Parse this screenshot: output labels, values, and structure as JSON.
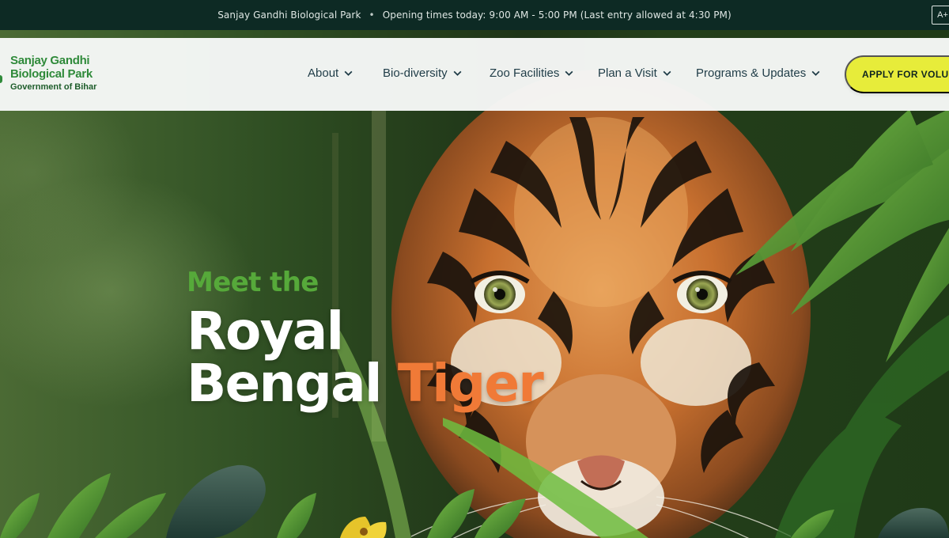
{
  "topbar": {
    "park_name": "Sanjay Gandhi Biological Park",
    "separator": "•",
    "timings": "Opening times today: 9:00 AM - 5:00 PM (Last entry allowed at 4:30 PM)",
    "font_size_button": "A+"
  },
  "logo": {
    "line1": "Sanjay Gandhi",
    "line2": "Biological Park",
    "line3": "Government of Bihar"
  },
  "nav": {
    "items": [
      {
        "label": "About"
      },
      {
        "label": "Bio-diversity"
      },
      {
        "label": "Zoo Facilities"
      },
      {
        "label": "Plan a Visit"
      },
      {
        "label": "Programs & Updates"
      }
    ],
    "cta_label": "APPLY FOR VOLUNTEER"
  },
  "hero": {
    "kicker": "Meet the",
    "headline_line1": "Royal",
    "headline_line2_main": "Bengal",
    "headline_line2_accent": "Tiger"
  },
  "colors": {
    "topbar_bg": "#0d2a24",
    "brand_green": "#2f8a3a",
    "nav_text": "#1f3c47",
    "cta_bg": "#e7ec3a",
    "kicker_green": "#56a93a",
    "accent_orange": "#f07a37"
  }
}
